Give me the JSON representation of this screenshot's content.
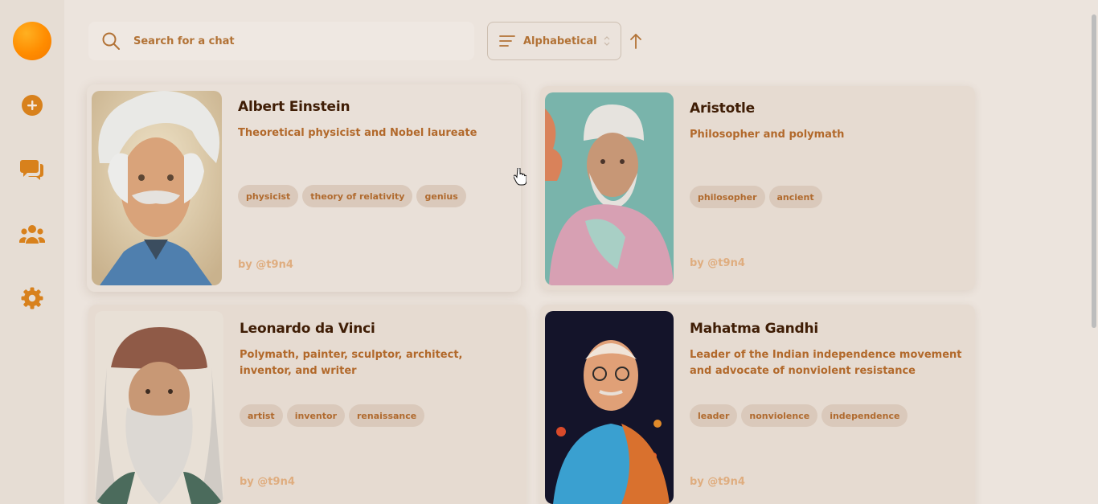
{
  "search": {
    "placeholder": "Search for a chat"
  },
  "sort": {
    "label": "Alphabetical",
    "direction": "ascending"
  },
  "sidebar": {
    "icons": [
      "new-chat-icon",
      "chats-icon",
      "characters-icon",
      "settings-icon"
    ]
  },
  "colors": {
    "accent": "#ff8c00",
    "icon": "#d8811c",
    "title": "#3f1d05",
    "description": "#b2692b",
    "tag_bg": "#dac9bb",
    "tag_text": "#b06a2e",
    "author": "#dfad7f"
  },
  "characters": [
    {
      "name": "Albert Einstein",
      "description": "Theoretical physicist and Nobel laureate",
      "tags": [
        "physicist",
        "theory of relativity",
        "genius"
      ],
      "author": "by @t9n4"
    },
    {
      "name": "Aristotle",
      "description": "Philosopher and polymath",
      "tags": [
        "philosopher",
        "ancient"
      ],
      "author": "by @t9n4"
    },
    {
      "name": "Leonardo da Vinci",
      "description": "Polymath, painter, sculptor, architect, inventor, and writer",
      "tags": [
        "artist",
        "inventor",
        "renaissance"
      ],
      "author": "by @t9n4"
    },
    {
      "name": "Mahatma Gandhi",
      "description": "Leader of the Indian independence movement and advocate of nonviolent resistance",
      "tags": [
        "leader",
        "nonviolence",
        "independence"
      ],
      "author": "by @t9n4"
    }
  ]
}
